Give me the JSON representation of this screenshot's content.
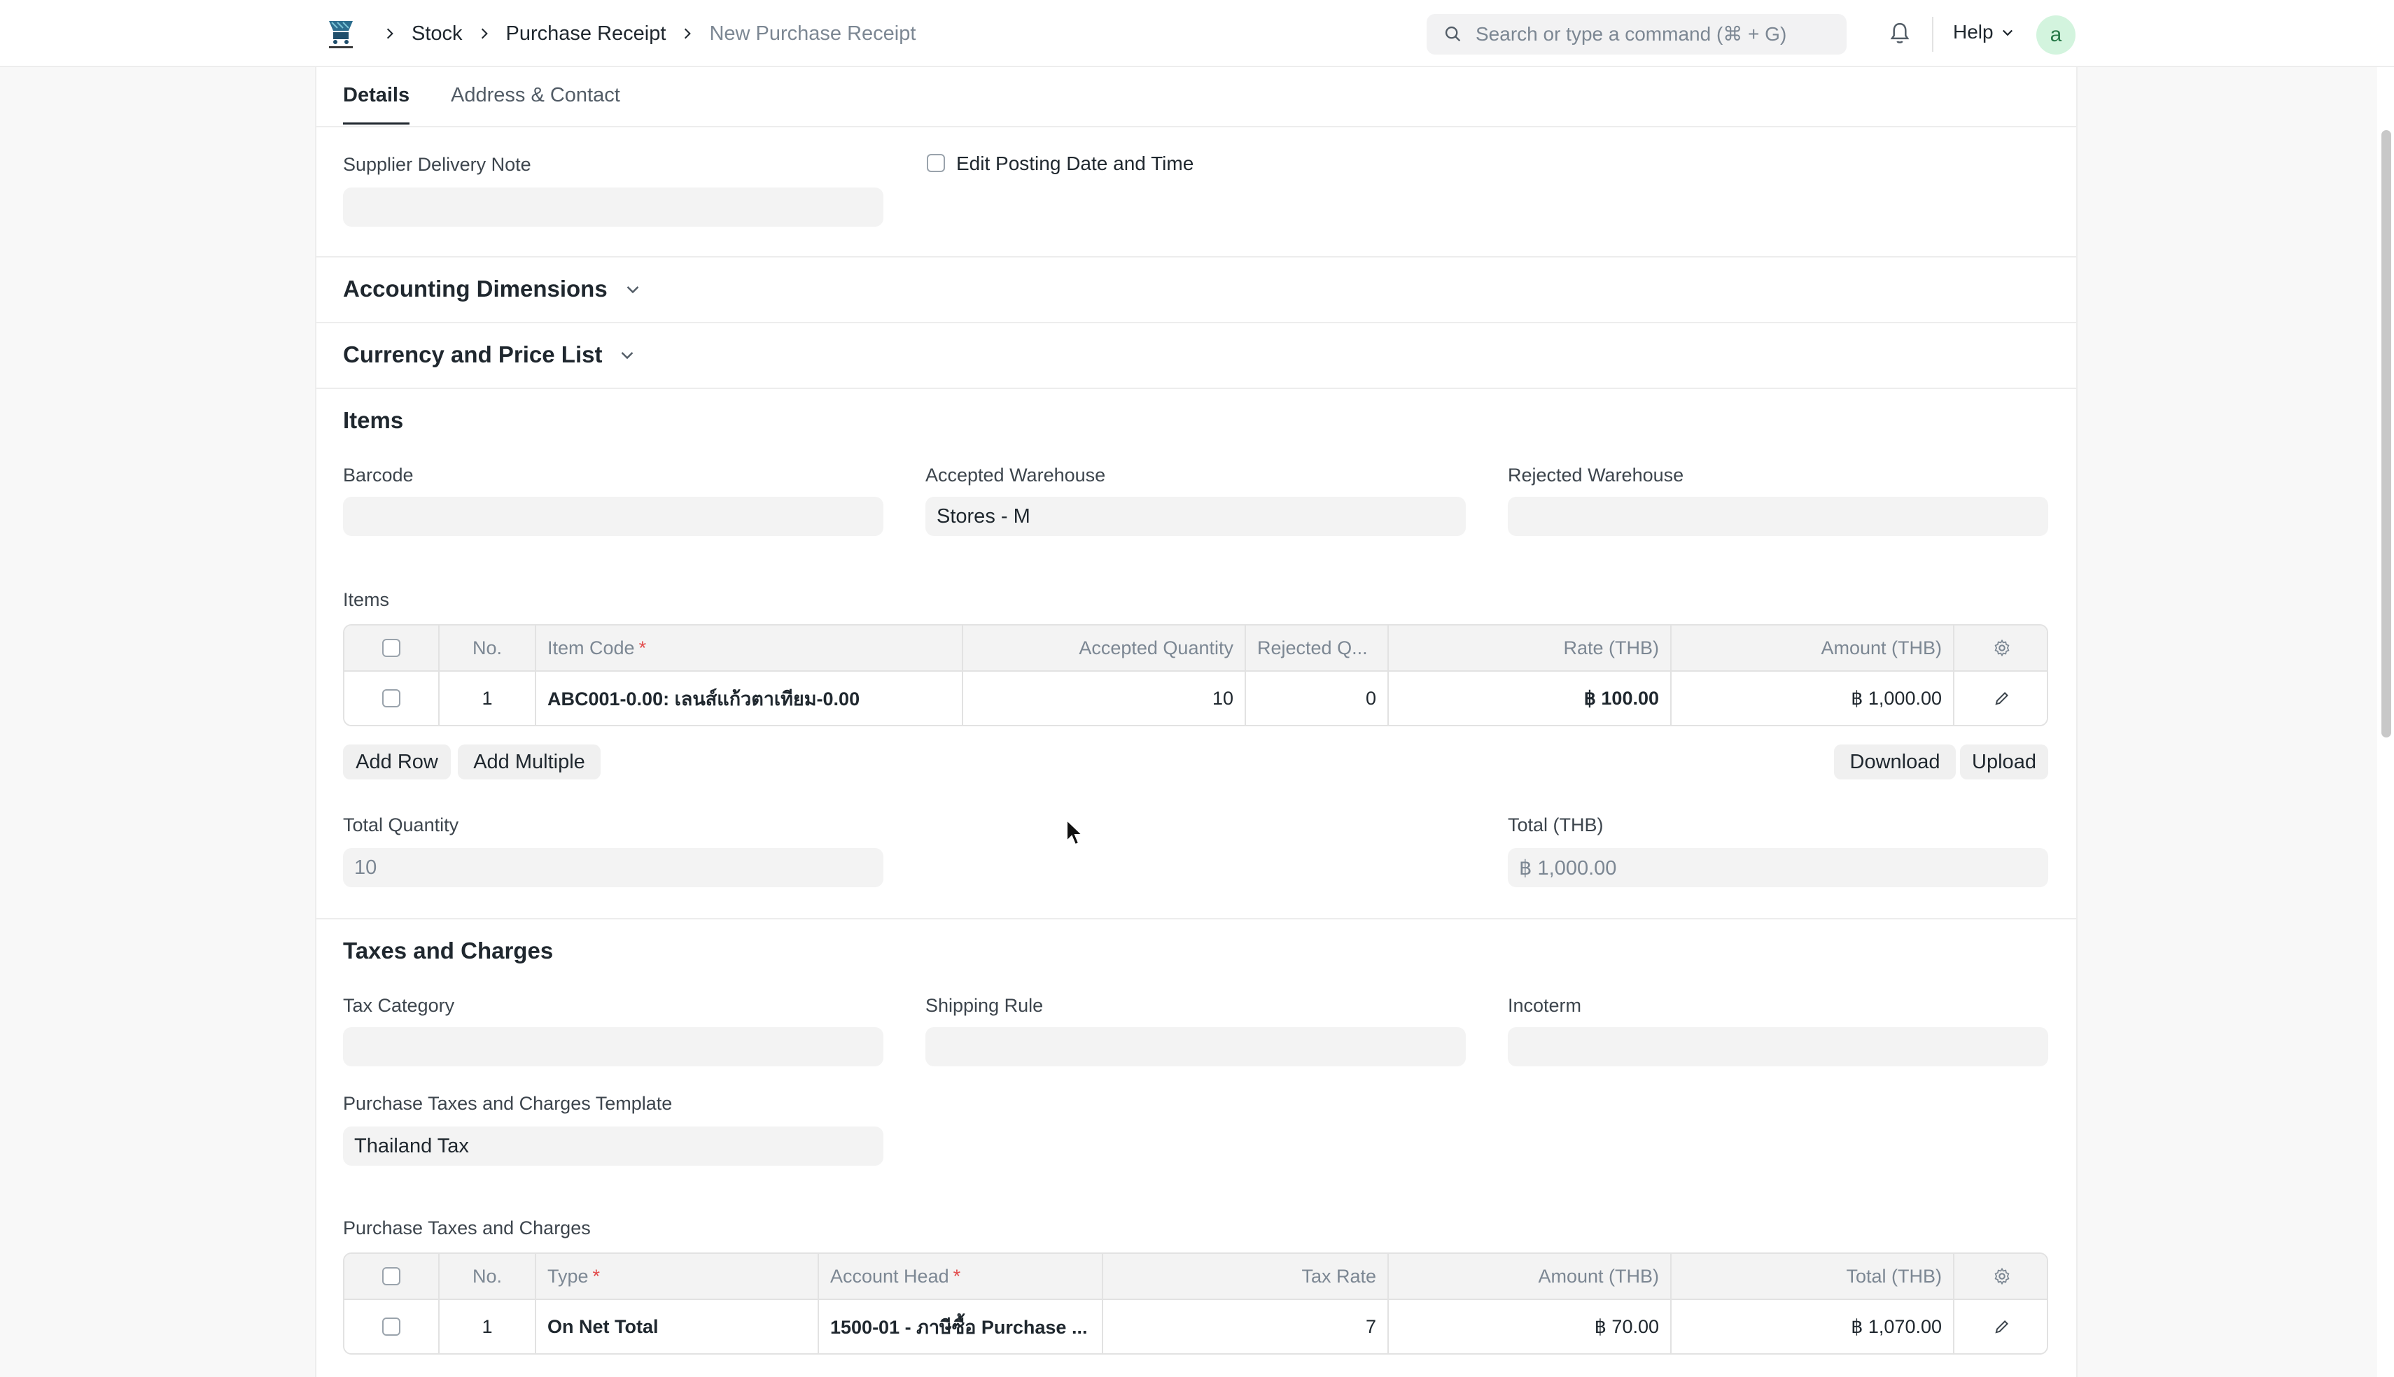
{
  "navbar": {
    "breadcrumbs": [
      "Stock",
      "Purchase Receipt",
      "New Purchase Receipt"
    ],
    "search_placeholder": "Search or type a command (⌘ + G)",
    "help_label": "Help",
    "avatar_letter": "a"
  },
  "tabs": [
    "Details",
    "Address & Contact"
  ],
  "details": {
    "supplier_delivery_note_label": "Supplier Delivery Note",
    "supplier_delivery_note_value": "",
    "edit_posting_label": "Edit Posting Date and Time"
  },
  "sections": {
    "accounting_dimensions": "Accounting Dimensions",
    "currency_price_list": "Currency and Price List",
    "items": "Items",
    "taxes": "Taxes and Charges"
  },
  "items_section": {
    "barcode_label": "Barcode",
    "barcode_value": "",
    "accepted_warehouse_label": "Accepted Warehouse",
    "accepted_warehouse_value": "Stores - M",
    "rejected_warehouse_label": "Rejected Warehouse",
    "rejected_warehouse_value": "",
    "table_label": "Items",
    "columns": [
      "No.",
      "Item Code",
      "Accepted Quantity",
      "Rejected Q...",
      "Rate (THB)",
      "Amount (THB)"
    ],
    "rows": [
      {
        "no": "1",
        "item_code": "ABC001-0.00: เลนส์แก้วตาเทียม-0.00",
        "accepted_qty": "10",
        "rejected_qty": "0",
        "rate": "฿ 100.00",
        "amount": "฿ 1,000.00"
      }
    ],
    "buttons": {
      "add_row": "Add Row",
      "add_multiple": "Add Multiple",
      "download": "Download",
      "upload": "Upload"
    },
    "total_quantity_label": "Total Quantity",
    "total_quantity_value": "10",
    "total_label": "Total (THB)",
    "total_value": "฿ 1,000.00"
  },
  "taxes_section": {
    "tax_category_label": "Tax Category",
    "shipping_rule_label": "Shipping Rule",
    "incoterm_label": "Incoterm",
    "template_label": "Purchase Taxes and Charges Template",
    "template_value": "Thailand Tax",
    "table_label": "Purchase Taxes and Charges",
    "columns": [
      "No.",
      "Type",
      "Account Head",
      "Tax Rate",
      "Amount (THB)",
      "Total (THB)"
    ],
    "rows": [
      {
        "no": "1",
        "type": "On Net Total",
        "account_head": "1500-01 - ภาษีซื้อ Purchase ...",
        "tax_rate": "7",
        "amount": "฿ 70.00",
        "total": "฿ 1,070.00"
      }
    ]
  }
}
